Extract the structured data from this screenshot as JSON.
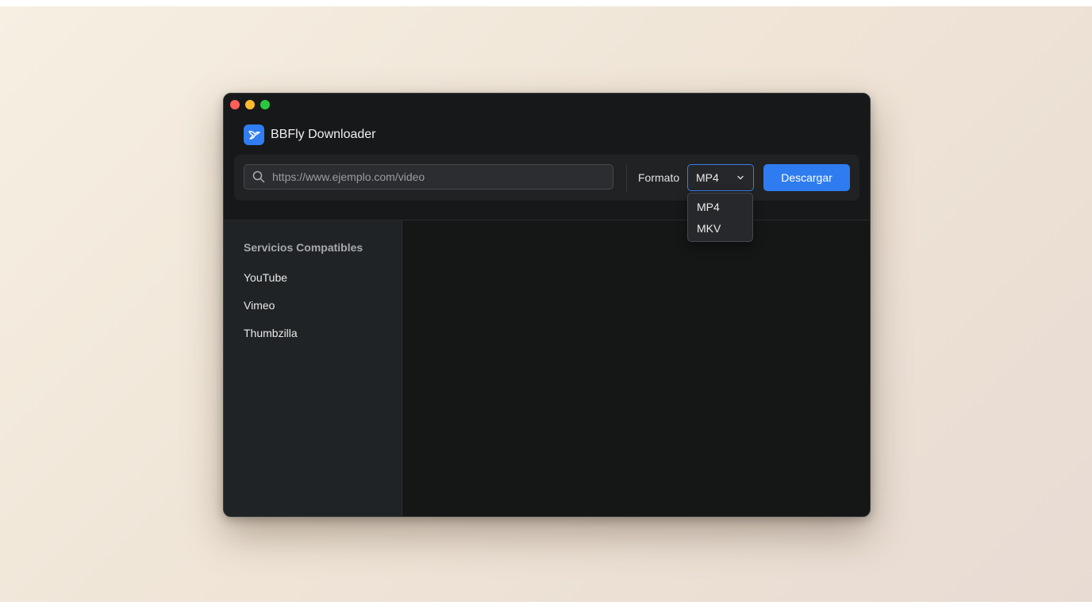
{
  "app": {
    "title": "BBFly Downloader"
  },
  "toolbar": {
    "url_placeholder": "https://www.ejemplo.com/video",
    "format_label": "Formato",
    "format_selected": "MP4",
    "download_label": "Descargar"
  },
  "format_dropdown": {
    "options": [
      "MP4",
      "MKV"
    ]
  },
  "sidebar": {
    "heading": "Servicios Compatibles",
    "items": [
      "YouTube",
      "Vimeo",
      "Thumbzilla"
    ]
  },
  "colors": {
    "accent": "#2f7cf0",
    "window_bg": "#161718",
    "sidebar_bg": "#202326"
  },
  "icons": {
    "search": "search-icon",
    "chevron": "chevron-down-icon",
    "logo": "app-logo-icon"
  }
}
